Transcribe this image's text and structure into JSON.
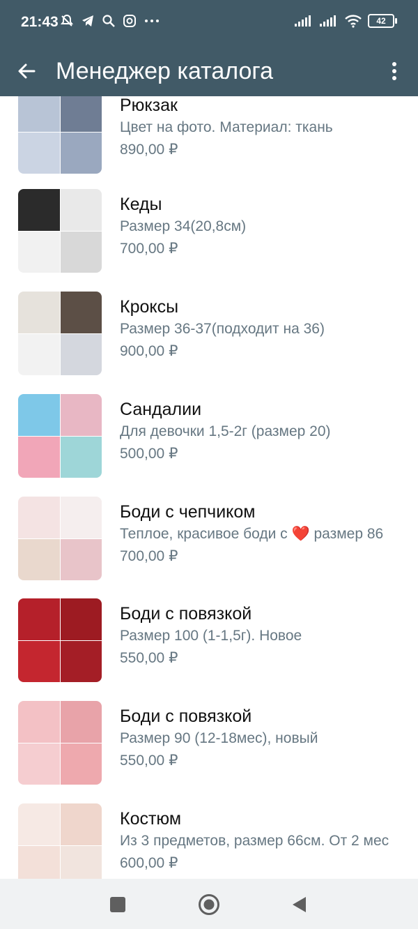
{
  "status": {
    "time": "21:43",
    "battery": "42"
  },
  "appbar": {
    "title": "Менеджер каталога"
  },
  "items": [
    {
      "name": "Рюкзак",
      "desc": "Цвет на фото. Материал: ткань",
      "price": "890,00 ₽",
      "colors": [
        "#b8c4d6",
        "#6f7d94",
        "#cbd4e3",
        "#9aa8bf"
      ]
    },
    {
      "name": "Кеды",
      "desc": "Размер 34(20,8см)",
      "price": "700,00 ₽",
      "colors": [
        "#2b2b2b",
        "#e9e9e9",
        "#f1f1f1",
        "#d8d8d8"
      ]
    },
    {
      "name": "Кроксы",
      "desc": "Размер 36-37(подходит на 36)",
      "price": "900,00 ₽",
      "colors": [
        "#e6e2dc",
        "#5c4f46",
        "#f2f2f2",
        "#d4d7de"
      ]
    },
    {
      "name": "Сандалии",
      "desc": "Для девочки 1,5-2г (размер 20)",
      "price": "500,00 ₽",
      "colors": [
        "#7ec8e8",
        "#e8b7c4",
        "#f1a6b8",
        "#9ed6d8"
      ]
    },
    {
      "name": "Боди с чепчиком",
      "desc": "Теплое, красивое боди с ❤️ размер 86",
      "price": "700,00 ₽",
      "colors": [
        "#f4e3e3",
        "#f5eeee",
        "#e9d8cd",
        "#e8c4c9"
      ]
    },
    {
      "name": "Боди с повязкой",
      "desc": "Размер 100 (1-1,5г). Новое",
      "price": "550,00 ₽",
      "colors": [
        "#b5202a",
        "#9d1b22",
        "#c4262f",
        "#a41e26"
      ]
    },
    {
      "name": "Боди с повязкой",
      "desc": "Размер 90 (12-18мес), новый",
      "price": "550,00 ₽",
      "colors": [
        "#f3c1c5",
        "#e8a3a9",
        "#f5cdd0",
        "#eea9ae"
      ]
    },
    {
      "name": "Костюм",
      "desc": "Из 3 предметов, размер 66см. От 2 мес",
      "price": "600,00 ₽",
      "colors": [
        "#f6e9e4",
        "#efd6cc",
        "#f3e0d9",
        "#f1e4de"
      ]
    }
  ]
}
